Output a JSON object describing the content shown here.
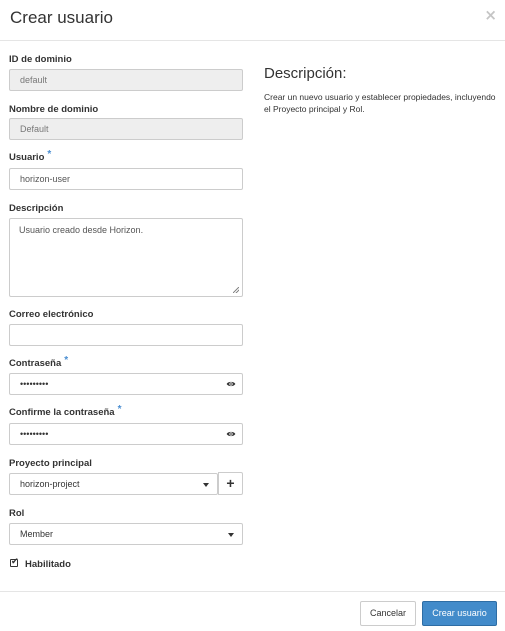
{
  "modal": {
    "title": "Crear usuario",
    "close_symbol": "×"
  },
  "form": {
    "domain_id": {
      "label": "ID de dominio",
      "value": "default"
    },
    "domain_name": {
      "label": "Nombre de dominio",
      "value": "Default"
    },
    "user": {
      "label": "Usuario",
      "required_mark": "*",
      "value": "horizon-user"
    },
    "description": {
      "label": "Descripción",
      "value": "Usuario creado desde Horizon."
    },
    "email": {
      "label": "Correo electrónico",
      "value": ""
    },
    "password": {
      "label": "Contraseña",
      "required_mark": "*",
      "value": "•••••••••"
    },
    "confirm_password": {
      "label": "Confirme la contraseña",
      "required_mark": "*",
      "value": "•••••••••"
    },
    "primary_project": {
      "label": "Proyecto principal",
      "value": "horizon-project",
      "add_symbol": "+"
    },
    "role": {
      "label": "Rol",
      "value": "Member"
    },
    "enabled": {
      "label": "Habilitado",
      "checked": true,
      "check_symbol": "✔"
    }
  },
  "help": {
    "title": "Descripción:",
    "text": "Crear un nuevo usuario y establecer propiedades, incluyendo el Proyecto principal y Rol."
  },
  "footer": {
    "cancel_label": "Cancelar",
    "submit_label": "Crear usuario"
  },
  "colors": {
    "primary": "#428bca",
    "required": "#4a8ed1",
    "readonly_bg": "#eeeeee"
  }
}
